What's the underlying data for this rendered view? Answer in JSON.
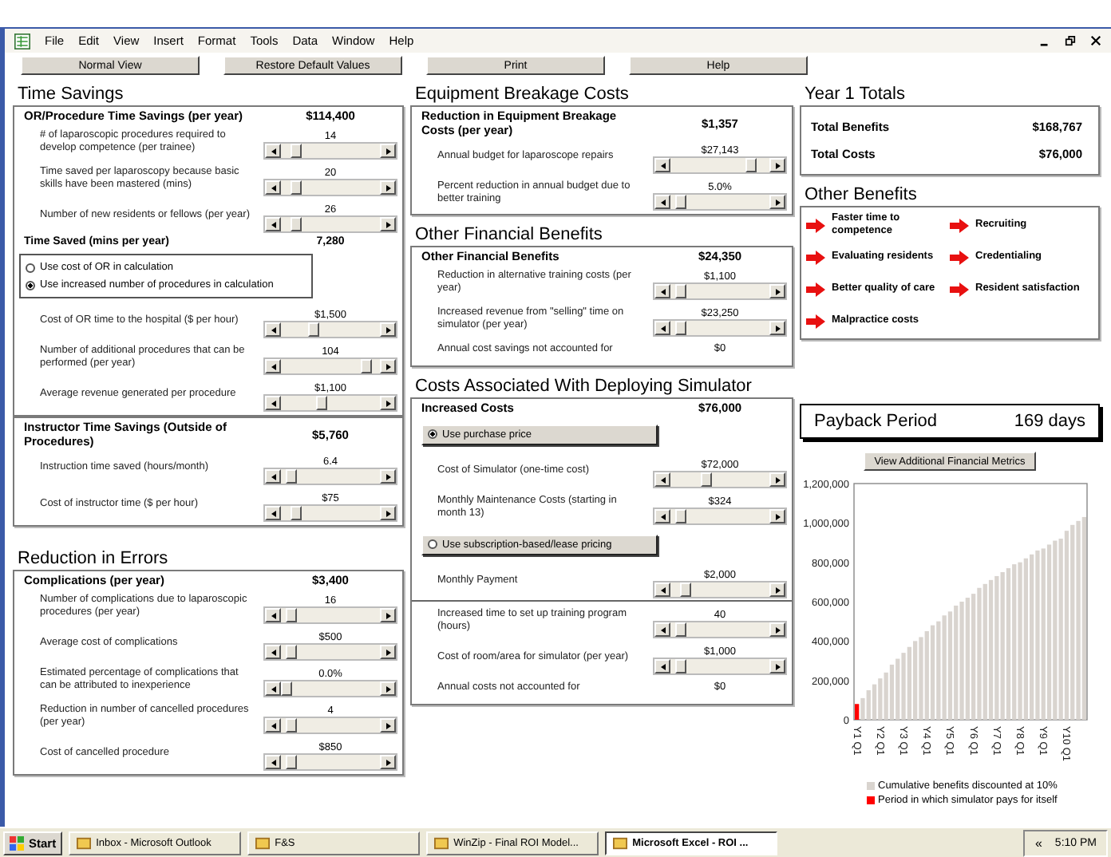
{
  "menu": [
    "File",
    "Edit",
    "View",
    "Insert",
    "Format",
    "Tools",
    "Data",
    "Window",
    "Help"
  ],
  "toolbar": [
    "Normal View",
    "Restore Default Values",
    "Print",
    "Help"
  ],
  "columns": [
    [
      {
        "title": "Time Savings",
        "boxes": [
          {
            "title": "OR/Procedure Time Savings (per year)",
            "value": "$114,400",
            "rows": [
              {
                "kind": "slider",
                "label": "# of laparoscopic procedures required to develop competence (per trainee)",
                "value": "14",
                "level": 0.1
              },
              {
                "kind": "slider",
                "label": "Time saved per laparoscopy because basic skills have been mastered (mins)",
                "value": "20",
                "level": 0.1
              },
              {
                "kind": "slider",
                "label": "Number of new residents or fellows (per year)",
                "value": "26",
                "level": 0.1
              },
              {
                "kind": "total",
                "label": "Time Saved (mins per year)",
                "value": "7,280"
              },
              {
                "kind": "radio-group",
                "options": [
                  {
                    "label": "Use cost of OR in calculation",
                    "selected": false
                  },
                  {
                    "label": "Use increased number of procedures in calculation",
                    "selected": true
                  }
                ]
              },
              {
                "kind": "slider",
                "label": "Cost of OR time to the hospital ($ per hour)",
                "value": "$1,500",
                "level": 0.3
              },
              {
                "kind": "slider",
                "label": "Number of additional procedures that can be performed (per year)",
                "value": "104",
                "level": 0.9
              },
              {
                "kind": "slider",
                "label": "Average revenue generated per procedure",
                "value": "$1,100",
                "level": 0.4
              }
            ]
          },
          {
            "title": "Instructor Time Savings (Outside of Procedures)",
            "value": "$5,760",
            "rows": [
              {
                "kind": "slider",
                "label": "Instruction time saved (hours/month)",
                "value": "6.4",
                "level": 0.05
              },
              {
                "kind": "slider",
                "label": "Cost of instructor time ($ per hour)",
                "value": "$75",
                "level": 0.1
              }
            ]
          }
        ]
      },
      {
        "title": "Reduction in Errors",
        "boxes": [
          {
            "title": "Complications (per year)",
            "value": "$3,400",
            "rows": [
              {
                "kind": "slider",
                "label": "Number of complications due to laparoscopic procedures (per year)",
                "value": "16",
                "level": 0.05
              },
              {
                "kind": "slider",
                "label": "Average cost of complications",
                "value": "$500",
                "level": 0.05
              },
              {
                "kind": "slider",
                "label": "Estimated percentage of complications that can be attributed to inexperience",
                "value": "0.0%",
                "level": 0.0
              },
              {
                "kind": "slider",
                "label": "Reduction in number of cancelled procedures (per year)",
                "value": "4",
                "level": 0.05
              },
              {
                "kind": "slider",
                "label": "Cost of cancelled procedure",
                "value": "$850",
                "level": 0.05
              }
            ]
          }
        ]
      }
    ],
    [
      {
        "title": "Equipment Breakage Costs",
        "boxes": [
          {
            "title": "Reduction in Equipment Breakage Costs (per year)",
            "value": "$1,357",
            "rows": [
              {
                "kind": "slider",
                "label": "Annual budget for laparoscope repairs",
                "value": "$27,143",
                "level": 0.85
              },
              {
                "kind": "slider",
                "label": "Percent reduction in annual budget due to better training",
                "value": "5.0%",
                "level": 0.05
              }
            ]
          }
        ]
      },
      {
        "title": "Other Financial Benefits",
        "boxes": [
          {
            "title": "Other Financial Benefits",
            "value": "$24,350",
            "rows": [
              {
                "kind": "slider",
                "label": "Reduction in alternative training costs (per year)",
                "value": "$1,100",
                "level": 0.05
              },
              {
                "kind": "slider",
                "label": "Increased revenue from \"selling\" time on simulator (per year)",
                "value": "$23,250",
                "level": 0.05
              },
              {
                "kind": "static",
                "label": "Annual cost savings not accounted for",
                "value": "$0"
              }
            ]
          }
        ]
      },
      {
        "title": "Costs Associated With Deploying Simulator",
        "boxes": [
          {
            "title": "Increased Costs",
            "value": "$76,000",
            "rows": [
              {
                "kind": "option-button",
                "label": "Use purchase price",
                "selected": true
              },
              {
                "kind": "slider",
                "label": "Cost of Simulator (one-time cost)",
                "value": "$72,000",
                "level": 0.35
              },
              {
                "kind": "slider",
                "label": "Monthly Maintenance Costs (starting in month 13)",
                "value": "$324",
                "level": 0.05
              },
              {
                "kind": "option-button",
                "label": "Use subscription-based/lease pricing",
                "selected": false
              },
              {
                "kind": "slider",
                "label": "Monthly Payment",
                "value": "$2,000",
                "level": 0.1
              },
              {
                "kind": "divider"
              },
              {
                "kind": "slider",
                "label": "Increased time to set up training program (hours)",
                "value": "40",
                "level": 0.05
              },
              {
                "kind": "slider",
                "label": "Cost of room/area for simulator (per year)",
                "value": "$1,000",
                "level": 0.05
              },
              {
                "kind": "static",
                "label": "Annual costs not accounted for",
                "value": "$0"
              }
            ]
          }
        ]
      }
    ]
  ],
  "year_totals": {
    "title": "Year 1 Totals",
    "rows": [
      {
        "label": "Total Benefits",
        "value": "$168,767"
      },
      {
        "label": "Total Costs",
        "value": "$76,000"
      }
    ]
  },
  "other_benefits": {
    "title": "Other Benefits",
    "items": [
      "Faster time to competence",
      "Recruiting",
      "Evaluating residents",
      "Credentialing",
      "Better quality of care",
      "Resident satisfaction",
      "Malpractice costs"
    ]
  },
  "payback": {
    "label": "Payback Period",
    "value": "169 days"
  },
  "metrics_button": "View Additional Financial Metrics",
  "chart_data": {
    "type": "bar",
    "legend": "bottom",
    "categories": [
      "Y1 Q1",
      null,
      null,
      null,
      "Y2 Q1",
      null,
      null,
      null,
      "Y3 Q1",
      null,
      null,
      null,
      "Y4 Q1",
      null,
      null,
      null,
      "Y5 Q1",
      null,
      null,
      null,
      "Y6 Q1",
      null,
      null,
      null,
      "Y7 Q1",
      null,
      null,
      null,
      "Y8 Q1",
      null,
      null,
      null,
      "Y9 Q1",
      null,
      null,
      null,
      "Y10 Q1",
      null,
      null,
      null
    ],
    "ylim": [
      0,
      1200000
    ],
    "yticks": [
      {
        "value": 0,
        "label": "0"
      },
      {
        "value": 200000,
        "label": "200,000"
      },
      {
        "value": 400000,
        "label": "400,000"
      },
      {
        "value": 600000,
        "label": "600,000"
      },
      {
        "value": 800000,
        "label": "800,000"
      },
      {
        "value": 1000000,
        "label": "1,000,000"
      },
      {
        "value": 1200000,
        "label": "1,200,000"
      }
    ],
    "series": [
      {
        "name": "Cumulative benefits discounted at 10%",
        "color": "#d9d4cf",
        "values": [
          null,
          110000,
          150000,
          180000,
          210000,
          240000,
          280000,
          310000,
          340000,
          370000,
          400000,
          420000,
          450000,
          480000,
          500000,
          530000,
          550000,
          580000,
          600000,
          620000,
          640000,
          670000,
          690000,
          710000,
          730000,
          750000,
          770000,
          790000,
          800000,
          820000,
          840000,
          860000,
          870000,
          890000,
          910000,
          920000,
          960000,
          990000,
          1010000,
          1030000
        ]
      },
      {
        "name": "Period in which simulator pays for itself",
        "color": "#ff0000",
        "values": [
          80000,
          null,
          null,
          null,
          null,
          null,
          null,
          null,
          null,
          null,
          null,
          null,
          null,
          null,
          null,
          null,
          null,
          null,
          null,
          null,
          null,
          null,
          null,
          null,
          null,
          null,
          null,
          null,
          null,
          null,
          null,
          null,
          null,
          null,
          null,
          null,
          null,
          null,
          null,
          null
        ]
      }
    ]
  },
  "taskbar": {
    "start": "Start",
    "items": [
      {
        "label": "Inbox - Microsoft Outlook",
        "selected": false
      },
      {
        "label": "F&S",
        "selected": false
      },
      {
        "label": "WinZip - Final ROI Model...",
        "selected": false
      },
      {
        "label": "Microsoft Excel - ROI ...",
        "selected": true
      }
    ],
    "tray_toggle": "«",
    "clock": "5:10 PM"
  }
}
